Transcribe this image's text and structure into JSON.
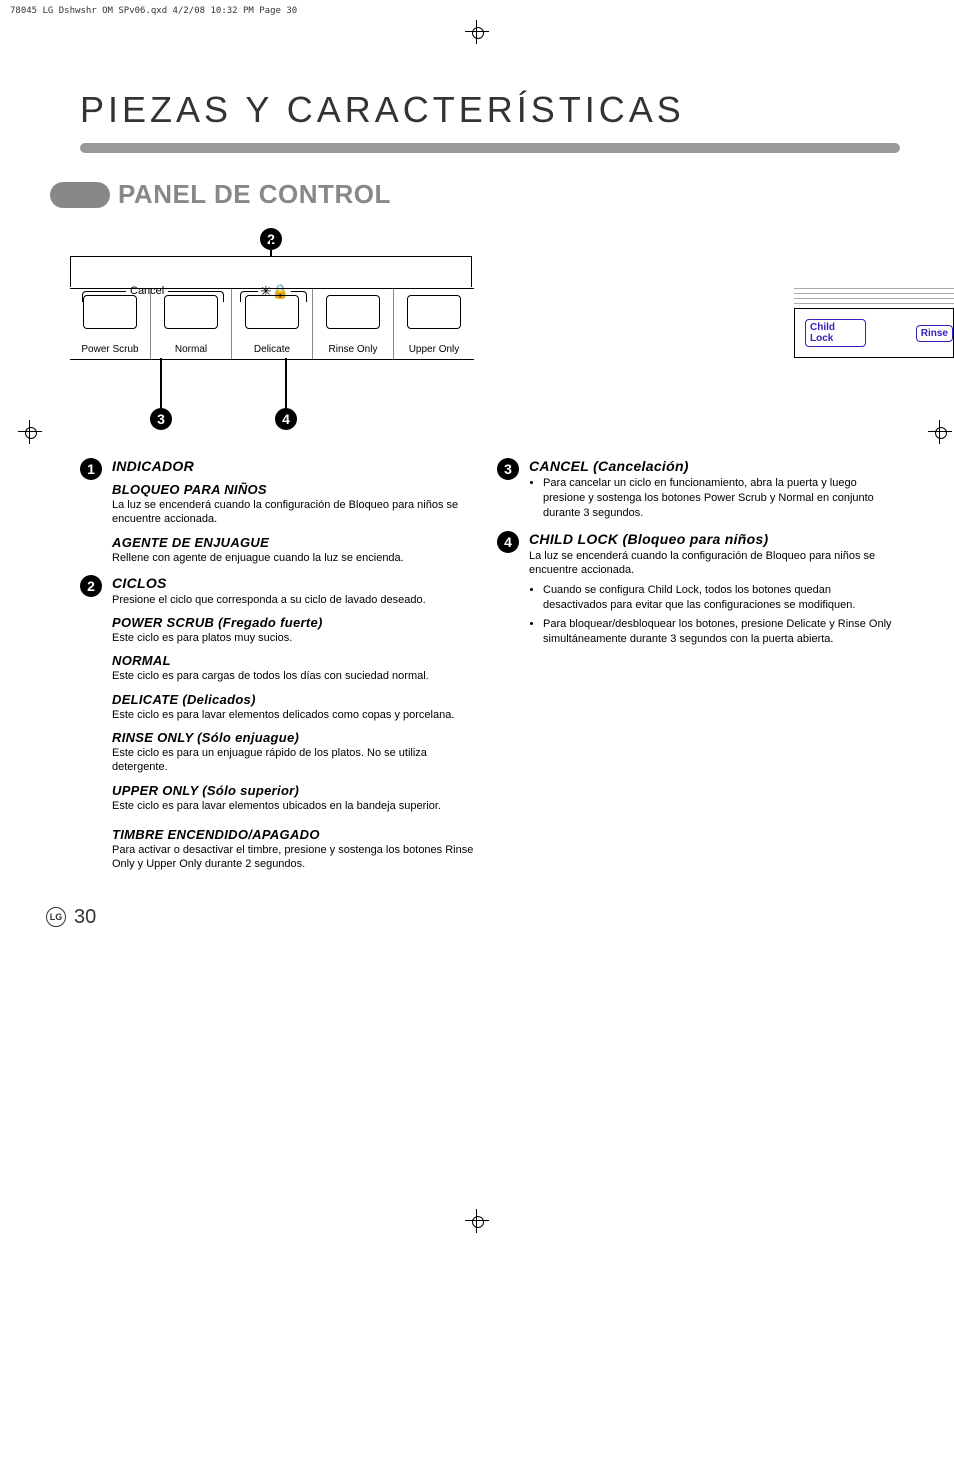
{
  "header_line": "78045 LG Dshwshr OM SPv06.qxd  4/2/08  10:32 PM  Page 30",
  "page_title": "PIEZAS Y CARACTERÍSTICAS",
  "section_title": "PANEL DE CONTROL",
  "panel_buttons": {
    "power_scrub": "Power Scrub",
    "normal": "Normal",
    "delicate": "Delicate",
    "rinse_only": "Rinse Only",
    "upper_only": "Upper Only"
  },
  "cancel_label": "Cancel",
  "side_labels": {
    "child_lock": "Child Lock",
    "rinse": "Rinse"
  },
  "callouts": {
    "n1": "1",
    "n2": "2",
    "n3": "3",
    "n4": "4"
  },
  "col1": {
    "indicador": {
      "title": "INDICADOR",
      "bloqueo_h": "BLOQUEO PARA NIÑOS",
      "bloqueo_p": "La luz se encenderá cuando la configuración de Bloqueo para niños se encuentre accionada.",
      "agente_h": "AGENTE DE ENJUAGUE",
      "agente_p": "Rellene con agente de enjuague cuando la luz se encienda."
    },
    "ciclos": {
      "title": "CICLOS",
      "intro": "Presione el ciclo que corresponda a su ciclo de lavado deseado.",
      "power_scrub_h": "POWER SCRUB (Fregado fuerte)",
      "power_scrub_p": "Este ciclo es para platos muy sucios.",
      "normal_h": "NORMAL",
      "normal_p": "Este ciclo es para cargas de todos los días con suciedad normal.",
      "delicate_h": "DELICATE (Delicados)",
      "delicate_p": "Este ciclo es para lavar elementos delicados como copas y porcelana.",
      "rinse_h": "RINSE ONLY (Sólo enjuague)",
      "rinse_p": "Este ciclo es para un enjuague rápido de los platos. No se utiliza detergente.",
      "upper_h": "UPPER ONLY (Sólo superior)",
      "upper_p": "Este ciclo es para lavar elementos ubicados en la bandeja superior.",
      "timbre_h": "TIMBRE ENCENDIDO/APAGADO",
      "timbre_p": "Para activar o desactivar el timbre, presione y sostenga los botones Rinse Only y Upper Only durante 2 segundos."
    }
  },
  "col2": {
    "cancel": {
      "title": "CANCEL (Cancelación)",
      "b1": "Para cancelar un ciclo en funcionamiento, abra la puerta y luego presione y sostenga los botones Power Scrub y Normal en conjunto durante 3 segundos."
    },
    "childlock": {
      "title": "CHILD LOCK (Bloqueo para niños)",
      "intro": "La luz se encenderá cuando la configuración de Bloqueo para niños se encuentre accionada.",
      "b1": "Cuando se configura Child Lock, todos los botones quedan desactivados para evitar que las configuraciones se modifiquen.",
      "b2": "Para bloquear/desbloquear los botones, presione Delicate y Rinse Only simultáneamente durante 3 segundos con la puerta abierta."
    }
  },
  "page_number": "30"
}
